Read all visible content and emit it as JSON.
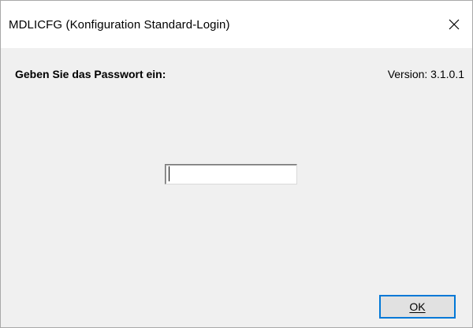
{
  "window": {
    "title": "MDLICFG (Konfiguration Standard-Login)",
    "close_icon": "close-x-icon"
  },
  "dialog": {
    "prompt": "Geben Sie das Passwort ein:",
    "version": "Version: 3.1.0.1",
    "password_value": "",
    "ok_label": "OK"
  },
  "colors": {
    "dialog_background": "#f0f0f0",
    "titlebar_background": "#ffffff",
    "default_button_border": "#0078d7"
  }
}
